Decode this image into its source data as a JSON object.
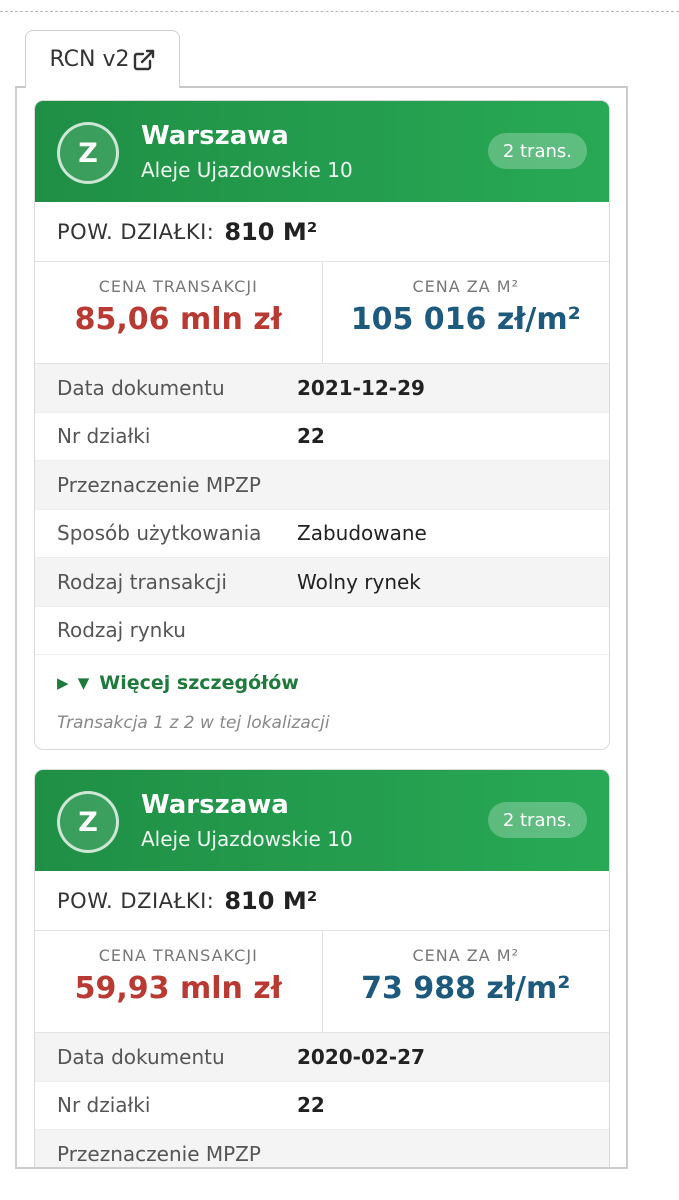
{
  "tab": {
    "label": "RCN v2",
    "icon": "external-link-icon"
  },
  "cards": [
    {
      "avatar_letter": "Z",
      "city": "Warszawa",
      "address": "Aleje Ujazdowskie 10",
      "badge": "2 trans.",
      "area_label": "POW. DZIAŁKI:",
      "area_value": "810 M²",
      "price_label": "CENA TRANSAKCJI",
      "price_value": "85,06 mln zł",
      "price_m2_label": "CENA ZA M²",
      "price_m2_value": "105 016 zł/m²",
      "rows": [
        {
          "label": "Data dokumentu",
          "value": "2021-12-29"
        },
        {
          "label": "Nr działki",
          "value": "22"
        },
        {
          "label": "Przeznaczenie MPZP",
          "value": ""
        },
        {
          "label": "Sposób użytkowania",
          "value": "Zabudowane"
        },
        {
          "label": "Rodzaj transakcji",
          "value": "Wolny rynek"
        },
        {
          "label": "Rodzaj rynku",
          "value": ""
        }
      ],
      "more_label": "Więcej szczegółów",
      "note": "Transakcja 1 z 2 w tej lokalizacji"
    },
    {
      "avatar_letter": "Z",
      "city": "Warszawa",
      "address": "Aleje Ujazdowskie 10",
      "badge": "2 trans.",
      "area_label": "POW. DZIAŁKI:",
      "area_value": "810 M²",
      "price_label": "CENA TRANSAKCJI",
      "price_value": "59,93 mln zł",
      "price_m2_label": "CENA ZA M²",
      "price_m2_value": "73 988 zł/m²",
      "rows": [
        {
          "label": "Data dokumentu",
          "value": "2020-02-27"
        },
        {
          "label": "Nr działki",
          "value": "22"
        },
        {
          "label": "Przeznaczenie MPZP",
          "value": ""
        }
      ]
    }
  ],
  "colors": {
    "header_green": "#1f8f45",
    "price_red": "#b83a32",
    "price_blue": "#1e5a7e",
    "link_green": "#1f7a3c"
  }
}
